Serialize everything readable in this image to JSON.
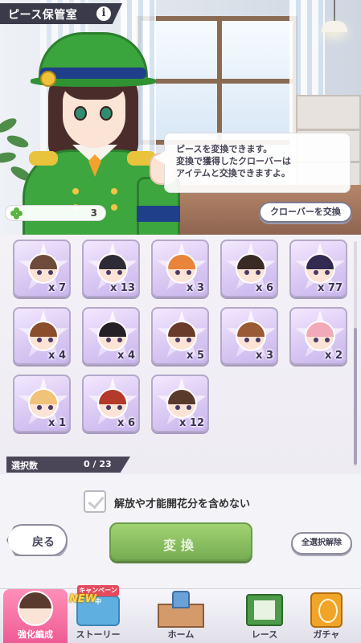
{
  "header": {
    "title": "ピース保管室",
    "info_icon": "i"
  },
  "dialog": {
    "lines": [
      "ピースを変換できます。",
      "変換で獲得したクローバーは",
      "アイテムと交換できますよ。"
    ]
  },
  "clover": {
    "icon": "clover-icon",
    "count": "3",
    "exchange_label": "クローバーを交換"
  },
  "pieces": [
    {
      "count": "x 7",
      "hair": "#6e4b3a"
    },
    {
      "count": "x 13",
      "hair": "#2f2b36"
    },
    {
      "count": "x 3",
      "hair": "#e9853a"
    },
    {
      "count": "x 6",
      "hair": "#3a2a24"
    },
    {
      "count": "x 77",
      "hair": "#332a52"
    },
    {
      "count": "x 4",
      "hair": "#8a4e2c"
    },
    {
      "count": "x 4",
      "hair": "#242026"
    },
    {
      "count": "x 5",
      "hair": "#6a3b2a"
    },
    {
      "count": "x 3",
      "hair": "#9a5a34"
    },
    {
      "count": "x 2",
      "hair": "#f2a9b8"
    },
    {
      "count": "x 1",
      "hair": "#f1c27a"
    },
    {
      "count": "x 6",
      "hair": "#b43a2a"
    },
    {
      "count": "x 12",
      "hair": "#5a3a2a"
    }
  ],
  "selection": {
    "label": "選択数",
    "count": "0 / 23"
  },
  "options": {
    "include_label": "解放や才能開花分を含めない",
    "checked": false
  },
  "buttons": {
    "back": "戻る",
    "convert": "変換",
    "deselect_all": "全選択解除"
  },
  "nav": {
    "campaign_badge": "キャンペーン中",
    "new_badge": "NEW",
    "items": [
      {
        "label": "強化編成",
        "icon": "team-icon",
        "active": true
      },
      {
        "label": "ストーリー",
        "icon": "story-icon",
        "active": false
      },
      {
        "label": "ホーム",
        "icon": "home-icon",
        "active": false
      },
      {
        "label": "レース",
        "icon": "race-icon",
        "active": false
      },
      {
        "label": "ガチャ",
        "icon": "gacha-icon",
        "active": false
      }
    ]
  },
  "colors": {
    "accent_pink": "#ee5b94",
    "convert_green": "#6aad3a",
    "card_purple": "#d8c7f2"
  }
}
